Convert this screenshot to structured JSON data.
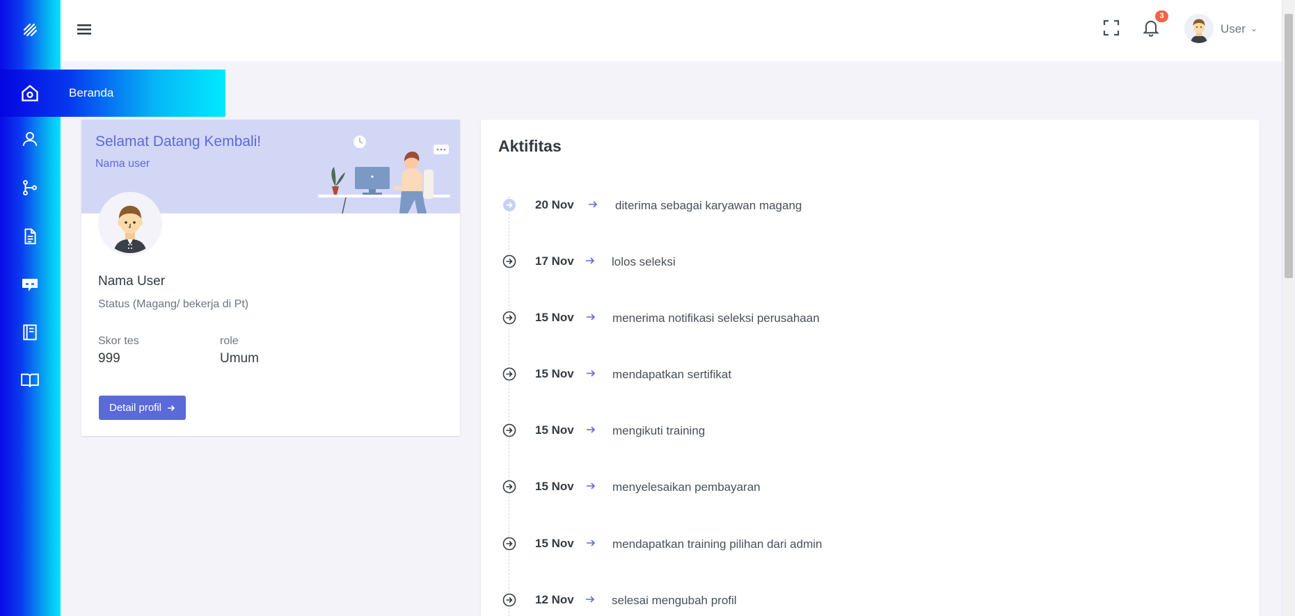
{
  "sidebar": {
    "active_label": "Beranda",
    "items": [
      {
        "icon": "home-icon"
      },
      {
        "icon": "user-icon"
      },
      {
        "icon": "branch-icon"
      },
      {
        "icon": "document-icon"
      },
      {
        "icon": "chat-icon"
      },
      {
        "icon": "notebook-icon"
      },
      {
        "icon": "book-open-icon"
      }
    ]
  },
  "header": {
    "notification_count": "3",
    "user_name": "User"
  },
  "profile": {
    "welcome": "Selamat Datang Kembali!",
    "name_small": "Nama user",
    "name": "Nama User",
    "status": "Status (Magang/ bekerja di Pt)",
    "score_label": "Skor tes",
    "score_value": "999",
    "role_label": "role",
    "role_value": "Umum",
    "button_label": "Detail profil"
  },
  "activity": {
    "title": "Aktifitas",
    "items": [
      {
        "date": "20 Nov",
        "text": "diterima sebagai karyawan magang"
      },
      {
        "date": "17 Nov",
        "text": "lolos seleksi"
      },
      {
        "date": "15 Nov",
        "text": "menerima notifikasi seleksi perusahaan"
      },
      {
        "date": "15 Nov",
        "text": "mendapatkan sertifikat"
      },
      {
        "date": "15 Nov",
        "text": "mengikuti training"
      },
      {
        "date": "15 Nov",
        "text": "menyelesaikan pembayaran"
      },
      {
        "date": "15 Nov",
        "text": "mendapatkan training pilihan dari admin"
      },
      {
        "date": "12 Nov",
        "text": "selesai mengubah profil"
      }
    ]
  },
  "colors": {
    "primary": "#5b6ad9",
    "banner": "#d3d7f6",
    "badge": "#f06548"
  }
}
